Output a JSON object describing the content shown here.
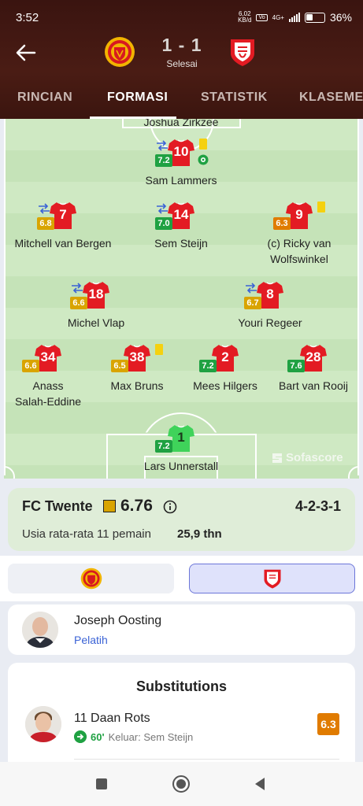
{
  "status_bar": {
    "time": "3:52",
    "net_speed_value": "6,02",
    "net_speed_unit": "KB/d",
    "network": "4G+",
    "battery": "36%"
  },
  "match": {
    "score": "1 - 1",
    "status": "Selesai"
  },
  "tabs": [
    {
      "label": "RINCIAN"
    },
    {
      "label": "FORMASI"
    },
    {
      "label": "STATISTIK"
    },
    {
      "label": "KLASEMEN"
    }
  ],
  "lineup": {
    "cut_off_name": "Joshua Zirkzee",
    "players": [
      {
        "number": "10",
        "name": "Sam Lammers",
        "rating": "7.2",
        "rating_color": "green",
        "sub": true,
        "card": true,
        "goal": true
      },
      {
        "number": "7",
        "name": "Mitchell van Bergen",
        "rating": "6.8",
        "rating_color": "yellow",
        "sub": true,
        "card": false
      },
      {
        "number": "14",
        "name": "Sem Steijn",
        "rating": "7.0",
        "rating_color": "green",
        "sub": true,
        "card": false
      },
      {
        "number": "9",
        "name_line1": "(c) Ricky van",
        "name_line2": "Wolfswinkel",
        "rating": "6.3",
        "rating_color": "orange",
        "sub": false,
        "card": true
      },
      {
        "number": "18",
        "name": "Michel Vlap",
        "rating": "6.6",
        "rating_color": "yellow",
        "sub": true
      },
      {
        "number": "8",
        "name": "Youri Regeer",
        "rating": "6.7",
        "rating_color": "yellow",
        "sub": true
      },
      {
        "number": "34",
        "name_line1": "Anass",
        "name_line2": "Salah-Eddine",
        "rating": "6.6",
        "rating_color": "yellow"
      },
      {
        "number": "38",
        "name": "Max Bruns",
        "rating": "6.5",
        "rating_color": "yellow",
        "card": true
      },
      {
        "number": "2",
        "name": "Mees Hilgers",
        "rating": "7.2",
        "rating_color": "green"
      },
      {
        "number": "28",
        "name": "Bart van Rooij",
        "rating": "7.6",
        "rating_color": "green"
      },
      {
        "number": "1",
        "name": "Lars Unnerstall",
        "rating": "7.2",
        "rating_color": "green"
      }
    ],
    "watermark": "Sofascore"
  },
  "team_info": {
    "name": "FC Twente",
    "rating": "6.76",
    "formation": "4-2-3-1",
    "avg_age_label": "Usia rata-rata 11 pemain",
    "avg_age_value": "25,9 thn"
  },
  "coach": {
    "name": "Joseph Oosting",
    "role": "Pelatih"
  },
  "substitutions": {
    "title": "Substitutions",
    "items": [
      {
        "name": "11 Daan Rots",
        "minute": "60'",
        "detail": "Keluar: Sem Steijn",
        "rating": "6.3"
      }
    ]
  },
  "colors": {
    "header_bg": "#3a1410",
    "jersey_red": "#e31b23",
    "rating_green": "#1fa142",
    "rating_yellow": "#d9a400",
    "rating_orange": "#e07b00",
    "keeper_green": "#3fd35a"
  }
}
